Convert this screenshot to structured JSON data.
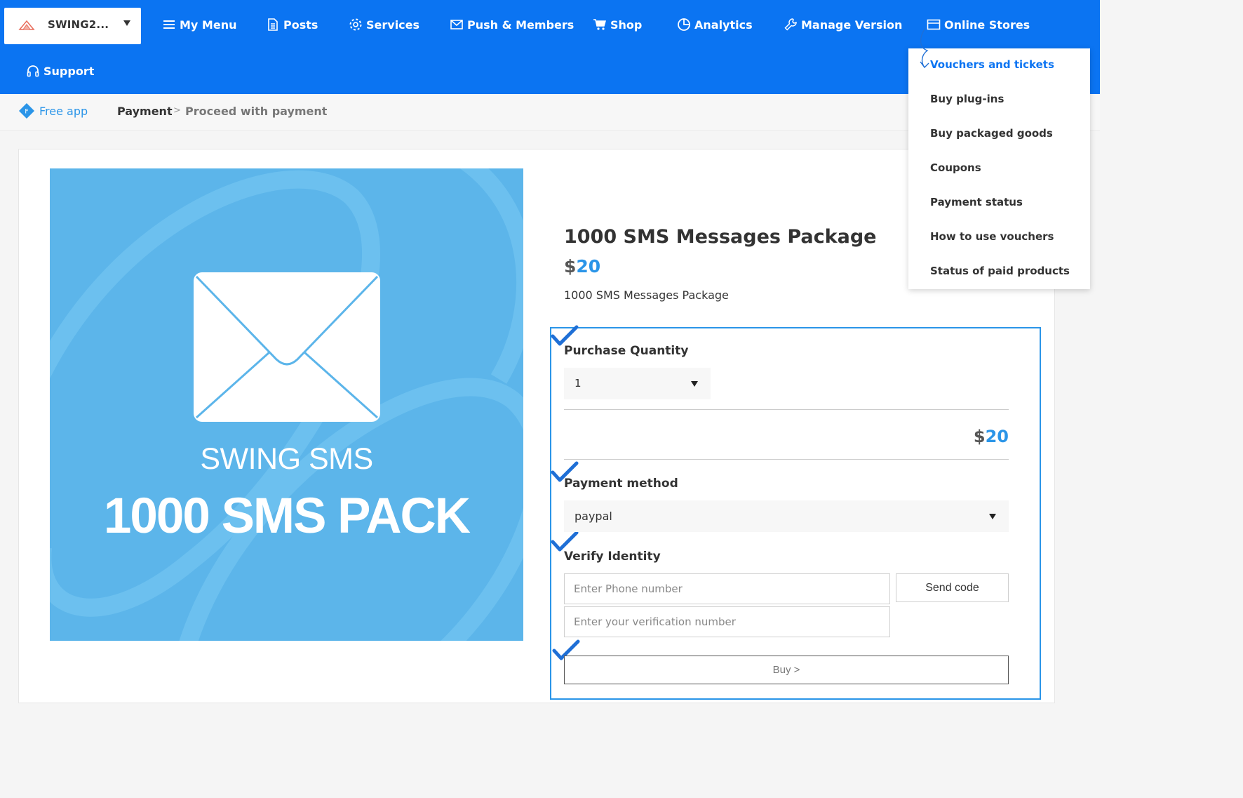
{
  "app_select": {
    "name": "SWING2..."
  },
  "nav": {
    "items": [
      {
        "label": "My Menu",
        "icon": "menu-icon"
      },
      {
        "label": "Posts",
        "icon": "document-icon"
      },
      {
        "label": "Services",
        "icon": "gear-icon"
      },
      {
        "label": "Push & Members",
        "icon": "mail-icon"
      },
      {
        "label": "Shop",
        "icon": "cart-icon"
      },
      {
        "label": "Analytics",
        "icon": "pie-chart-icon"
      },
      {
        "label": "Manage Version",
        "icon": "wrench-icon"
      },
      {
        "label": "Online Stores",
        "icon": "card-icon"
      },
      {
        "label": "Support",
        "icon": "headset-icon"
      }
    ]
  },
  "dropdown": {
    "items": [
      {
        "label": "Vouchers and tickets",
        "active": true
      },
      {
        "label": "Buy plug-ins"
      },
      {
        "label": "Buy packaged goods"
      },
      {
        "label": "Coupons"
      },
      {
        "label": "Payment status"
      },
      {
        "label": "How to use vouchers"
      },
      {
        "label": "Status of paid products"
      }
    ]
  },
  "breadcrumb": {
    "app_badge": "F",
    "app_label": "Free app",
    "section": "Payment",
    "separator": ">",
    "current": "Proceed with payment"
  },
  "product": {
    "image_brand": "SWING SMS",
    "image_title": "1000 SMS PACK",
    "title": "1000 SMS Messages Package",
    "currency": "$",
    "price": "20",
    "description": "1000 SMS Messages Package"
  },
  "order": {
    "quantity_label": "Purchase Quantity",
    "quantity_value": "1",
    "total_currency": "$",
    "total_value": "20",
    "payment_label": "Payment method",
    "payment_value": "paypal",
    "verify_label": "Verify Identity",
    "phone_placeholder": "Enter Phone number",
    "verification_placeholder": "Enter your verification number",
    "send_code_label": "Send code",
    "buy_label": "Buy >"
  },
  "colors": {
    "nav_background": "#0b74f2",
    "accent": "#2b95e8",
    "image_background": "#5cb5ea"
  }
}
